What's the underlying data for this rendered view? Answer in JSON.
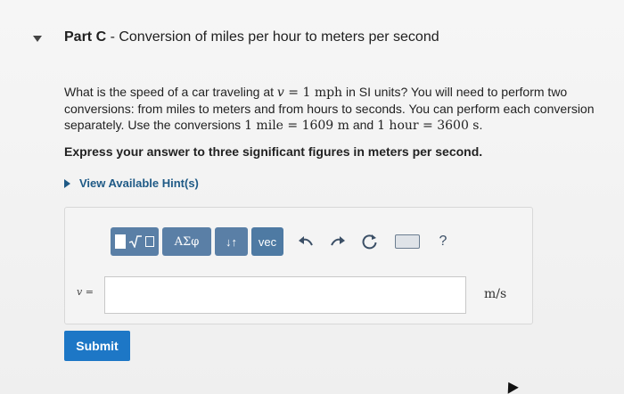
{
  "part": {
    "label": "Part C",
    "separator": " - ",
    "title": "Conversion of miles per hour to meters per second"
  },
  "question": {
    "text_1": "What is the speed of a car traveling at ",
    "speed_var": "v",
    "speed_eq": " = 1 mph",
    "text_2": " in SI units? You will need to perform two conversions: from miles to meters and from hours to seconds. You can perform each conversion separately. Use the conversions ",
    "conv_1": "1 mile = 1609 m",
    "text_3": " and ",
    "conv_2": "1 hour = 3600 s",
    "text_4": "."
  },
  "instruction": "Express your answer to three significant figures in meters per second.",
  "hints_label": "View Available Hint(s)",
  "toolbar": {
    "templates_icon": "templates-icon",
    "greek_label": "ΑΣφ",
    "arrows_label": "↓↑",
    "vec_label": "vec",
    "undo_icon": "undo-icon",
    "redo_icon": "redo-icon",
    "reset_icon": "reset-icon",
    "keyboard_icon": "keyboard-icon",
    "help_label": "?"
  },
  "answer": {
    "variable_label": "v =",
    "value": "",
    "units": "m/s"
  },
  "submit_label": "Submit"
}
